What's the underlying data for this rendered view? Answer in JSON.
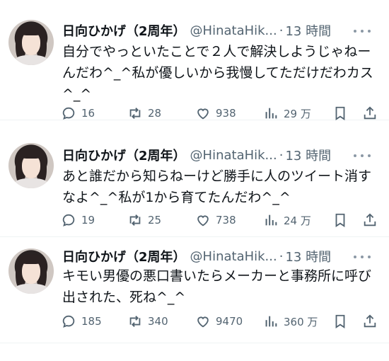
{
  "tweets": [
    {
      "name": "日向ひかげ（2周年）",
      "handle": "@HinataHik...",
      "separator": "·",
      "time": "13 時間",
      "text": "自分でやっといたことで２人で解決しようじゃねーんだわ^_^私が優しいから我慢してただけだわカス^_^",
      "replies": "16",
      "retweets": "28",
      "likes": "938",
      "views": "29 万"
    },
    {
      "name": "日向ひかげ（2周年）",
      "handle": "@HinataHik...",
      "separator": "·",
      "time": "13 時間",
      "text": "あと誰だから知らねーけど勝手に人のツイート消すなよ^_^私が1から育てたんだわ^_^",
      "replies": "19",
      "retweets": "25",
      "likes": "738",
      "views": "24 万"
    },
    {
      "name": "日向ひかげ（2周年）",
      "handle": "@HinataHik...",
      "separator": "·",
      "time": "13 時間",
      "text": "キモい男優の悪口書いたらメーカーと事務所に呼び出された、死ね^_^",
      "replies": "185",
      "retweets": "340",
      "likes": "9470",
      "views": "360 万"
    }
  ],
  "icons": {
    "reply": "comment-icon",
    "retweet": "retweet-icon",
    "like": "heart-icon",
    "views": "bar-chart-icon",
    "bookmark": "bookmark-icon",
    "share": "share-icon",
    "more": "more-dots-icon"
  },
  "colors": {
    "text": "#0f1419",
    "secondary": "#536471",
    "divider": "#eff3f4"
  }
}
